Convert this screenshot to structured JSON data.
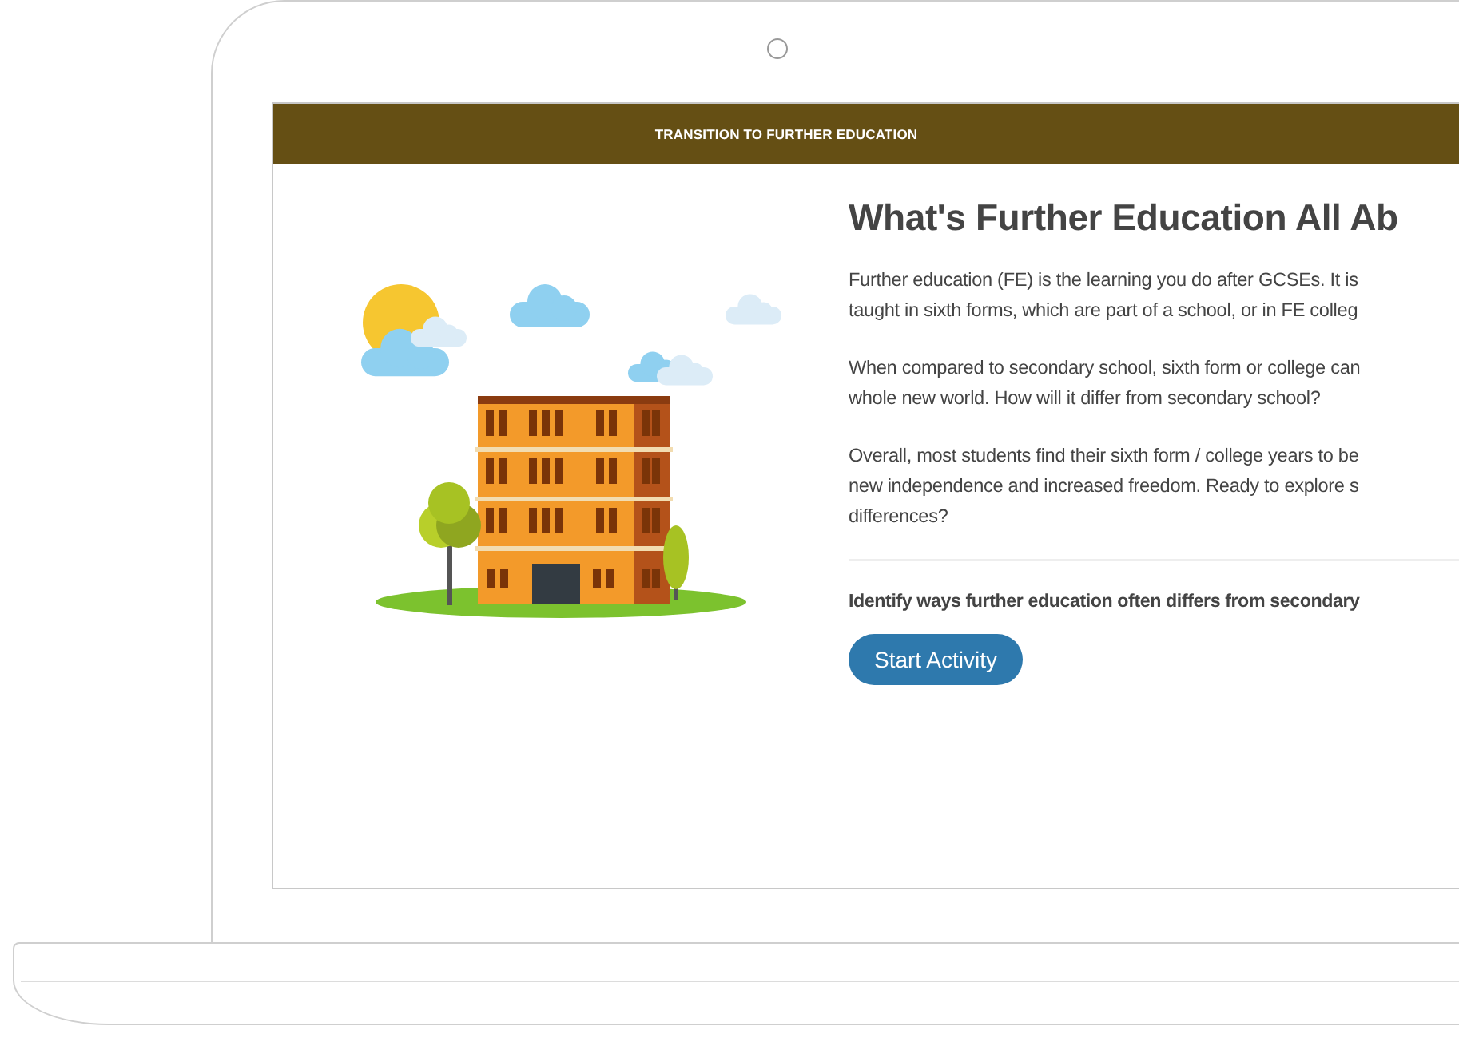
{
  "header": {
    "title": "TRANSITION TO FURTHER EDUCATION"
  },
  "content": {
    "heading": "What's Further Education All Ab",
    "paragraphs": [
      [
        "Further education (FE) is the learning you do after GCSEs. It is",
        "taught in sixth forms, which are part of a school, or in FE colleg"
      ],
      [
        "When compared to secondary school, sixth form or college can",
        "whole new world. How will it differ from secondary school?"
      ],
      [
        "Overall, most students find their sixth form / college years to be",
        "new independence and increased freedom. Ready to explore s",
        "differences?"
      ]
    ],
    "objective": "Identify ways further education often differs from secondary",
    "button": "Start Activity"
  }
}
